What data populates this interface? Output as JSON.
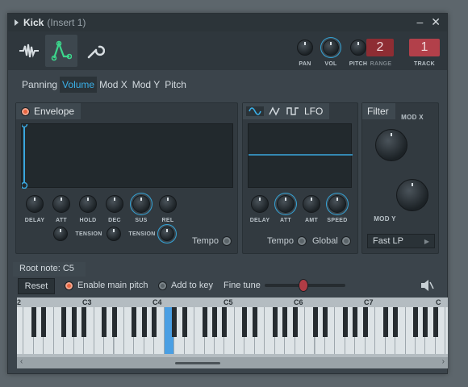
{
  "window": {
    "title": "Kick",
    "subtitle": "(Insert 1)",
    "minimize": "–",
    "close": "✕"
  },
  "toolbar": {
    "icons": [
      "waveform-icon",
      "envelope-icon",
      "wrench-icon"
    ],
    "pan_label": "PAN",
    "vol_label": "VOL",
    "pitch_label": "PITCH",
    "range_label": "RANGE",
    "range_value": "2",
    "track_label": "TRACK",
    "track_value": "1"
  },
  "tabs": [
    "Panning",
    "Volume",
    "Mod X",
    "Mod Y",
    "Pitch"
  ],
  "selected_tab": "Volume",
  "envelope": {
    "title": "Envelope",
    "knobs": [
      "DELAY",
      "ATT",
      "HOLD",
      "DEC",
      "SUS",
      "REL"
    ],
    "tension_label": "TENSION",
    "tempo_label": "Tempo"
  },
  "lfo": {
    "title": "LFO",
    "knobs": [
      "DELAY",
      "ATT",
      "AMT",
      "SPEED"
    ],
    "tempo_label": "Tempo",
    "global_label": "Global"
  },
  "filter": {
    "title": "Filter",
    "mod_x": "MOD X",
    "mod_y": "MOD Y",
    "type": "Fast LP"
  },
  "bottom": {
    "root_note": "Root note: C5",
    "reset": "Reset",
    "enable_main_pitch": "Enable main pitch",
    "add_to_key": "Add to key",
    "fine_tune": "Fine tune"
  },
  "keyboard": {
    "octave_labels": [
      "2",
      "C3",
      "C4",
      "C5",
      "C6",
      "C7",
      "C"
    ],
    "highlighted_key": "C5"
  }
}
